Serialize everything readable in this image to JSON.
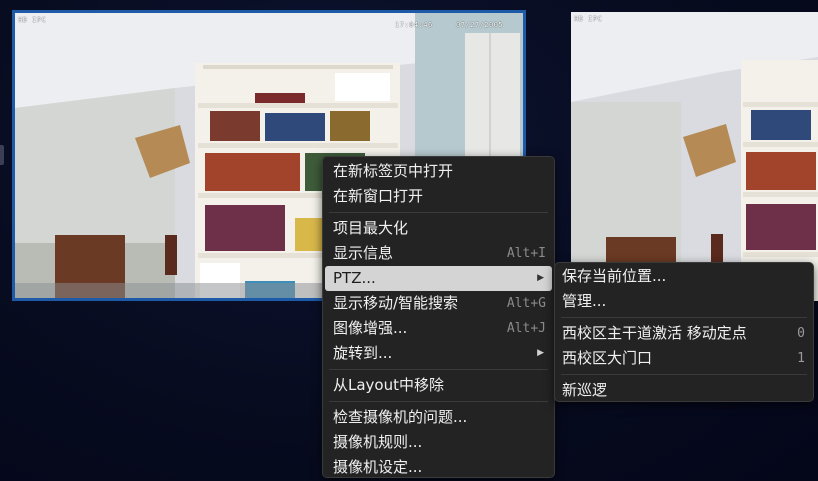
{
  "camera_main": {
    "osd_label": "HD IPC",
    "osd_time": "17:04:46",
    "osd_date": "07/27/2005"
  },
  "camera_side": {
    "osd_label": "HD IPC"
  },
  "context_menu": {
    "items": [
      {
        "label": "在新标签页中打开"
      },
      {
        "label": "在新窗口打开"
      },
      {
        "label": "项目最大化"
      },
      {
        "label": "显示信息",
        "shortcut": "Alt+I"
      },
      {
        "label": "PTZ..."
      },
      {
        "label": "显示移动/智能搜索",
        "shortcut": "Alt+G"
      },
      {
        "label": "图像增强...",
        "shortcut": "Alt+J"
      },
      {
        "label": "旋转到..."
      },
      {
        "label": "从Layout中移除"
      },
      {
        "label": "检查摄像机的问题..."
      },
      {
        "label": "摄像机规则..."
      },
      {
        "label": "摄像机设定..."
      }
    ],
    "submenu_arrow": "▶"
  },
  "ptz_submenu": {
    "items": [
      {
        "label": "保存当前位置..."
      },
      {
        "label": "管理..."
      },
      {
        "label": "西校区主干道激活 移动定点",
        "number": "0"
      },
      {
        "label": "西校区大门口",
        "number": "1"
      },
      {
        "label": "新巡逻"
      }
    ]
  },
  "colors": {
    "selection_bg": "#d4d4d4",
    "menu_bg": "#232323",
    "active_frame": "#1d5aa8"
  }
}
